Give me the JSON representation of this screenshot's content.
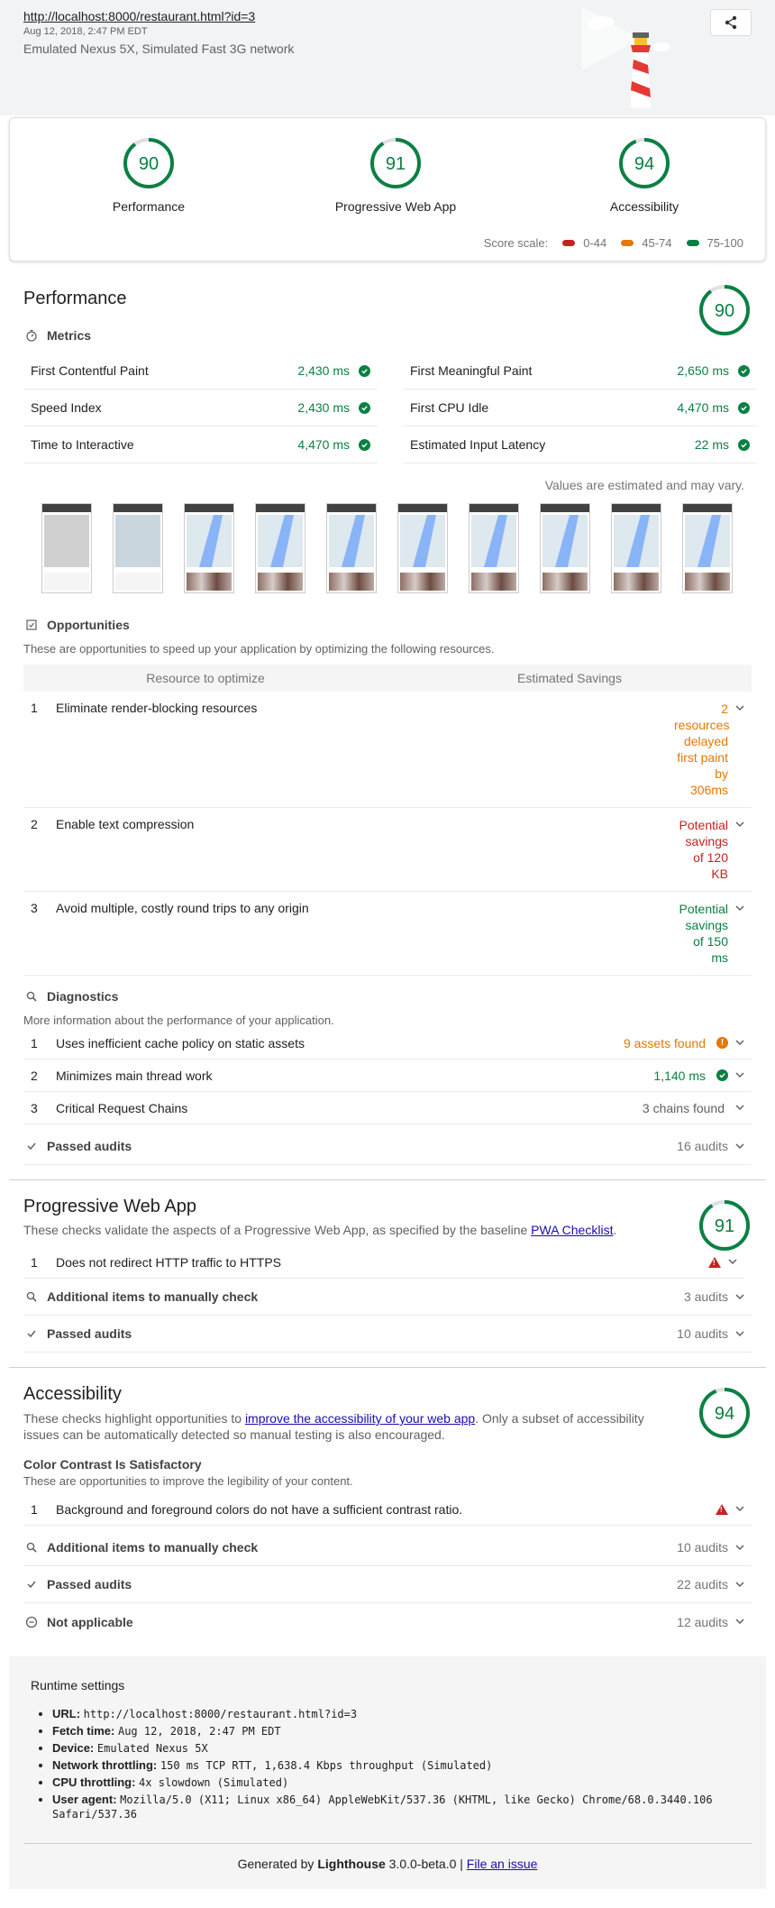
{
  "header": {
    "url": "http://localhost:8000/restaurant.html?id=3",
    "fetch_time": "Aug 12, 2018, 2:47 PM EDT",
    "device": "Emulated Nexus 5X, Simulated Fast 3G network",
    "share_icon": "share-icon"
  },
  "scores": {
    "items": [
      {
        "label": "Performance",
        "value": "90",
        "fraction": 0.9
      },
      {
        "label": "Progressive Web App",
        "value": "91",
        "fraction": 0.91
      },
      {
        "label": "Accessibility",
        "value": "94",
        "fraction": 0.94
      }
    ],
    "scale_label": "Score scale:",
    "scale": [
      {
        "label": "0-44",
        "color": "#c7221f"
      },
      {
        "label": "45-74",
        "color": "#e67700"
      },
      {
        "label": "75-100",
        "color": "#0b8043"
      }
    ]
  },
  "colors": {
    "pass": "#0b8043",
    "average": "#e67700",
    "fail": "#c7221f"
  },
  "performance": {
    "title": "Performance",
    "score": "90",
    "fraction": 0.9,
    "metrics_label": "Metrics",
    "metrics": [
      {
        "name": "First Contentful Paint",
        "value": "2,430 ms"
      },
      {
        "name": "First Meaningful Paint",
        "value": "2,650 ms"
      },
      {
        "name": "Speed Index",
        "value": "2,430 ms"
      },
      {
        "name": "First CPU Idle",
        "value": "4,470 ms"
      },
      {
        "name": "Time to Interactive",
        "value": "4,470 ms"
      },
      {
        "name": "Estimated Input Latency",
        "value": "22 ms"
      }
    ],
    "estimate_note": "Values are estimated and may vary.",
    "opportunities_label": "Opportunities",
    "opportunities_desc": "These are opportunities to speed up your application by optimizing the following resources.",
    "col_resource": "Resource to optimize",
    "col_savings": "Estimated Savings",
    "opportunities": [
      {
        "n": "1",
        "title": "Eliminate render-blocking resources",
        "savings": "2 resources delayed first paint by 306ms",
        "color": "#e67700"
      },
      {
        "n": "2",
        "title": "Enable text compression",
        "savings": "Potential savings of 120 KB",
        "color": "#c7221f"
      },
      {
        "n": "3",
        "title": "Avoid multiple, costly round trips to any origin",
        "savings": "Potential savings of 150 ms",
        "color": "#0b8043"
      }
    ],
    "diagnostics_label": "Diagnostics",
    "diagnostics_desc": "More information about the performance of your application.",
    "diagnostics": [
      {
        "n": "1",
        "title": "Uses inefficient cache policy on static assets",
        "value": "9 assets found"
      },
      {
        "n": "2",
        "title": "Minimizes main thread work",
        "value": "1,140 ms"
      },
      {
        "n": "3",
        "title": "Critical Request Chains",
        "value": "3 chains found"
      }
    ],
    "passed_label": "Passed audits",
    "passed_count": "16 audits"
  },
  "pwa": {
    "title": "Progressive Web App",
    "score": "91",
    "fraction": 0.91,
    "desc_prefix": "These checks validate the aspects of a Progressive Web App, as specified by the baseline ",
    "desc_link": "PWA Checklist",
    "desc_suffix": ".",
    "fail_n": "1",
    "fail_title": "Does not redirect HTTP traffic to HTTPS",
    "manual_label": "Additional items to manually check",
    "manual_count": "3 audits",
    "passed_label": "Passed audits",
    "passed_count": "10 audits"
  },
  "a11y": {
    "title": "Accessibility",
    "score": "94",
    "fraction": 0.94,
    "desc_prefix": "These checks highlight opportunities to ",
    "desc_link": "improve the accessibility of your web app",
    "desc_suffix": ". Only a subset of accessibility issues can be automatically detected so manual testing is also encouraged.",
    "group_title": "Color Contrast Is Satisfactory",
    "group_desc": "These are opportunities to improve the legibility of your content.",
    "fail_n": "1",
    "fail_title": "Background and foreground colors do not have a sufficient contrast ratio.",
    "manual_label": "Additional items to manually check",
    "manual_count": "10 audits",
    "passed_label": "Passed audits",
    "passed_count": "22 audits",
    "na_label": "Not applicable",
    "na_count": "12 audits"
  },
  "runtime": {
    "title": "Runtime settings",
    "items": [
      {
        "k": "URL:",
        "v": "http://localhost:8000/restaurant.html?id=3"
      },
      {
        "k": "Fetch time:",
        "v": "Aug 12, 2018, 2:47 PM EDT"
      },
      {
        "k": "Device:",
        "v": "Emulated Nexus 5X"
      },
      {
        "k": "Network throttling:",
        "v": "150 ms TCP RTT, 1,638.4 Kbps throughput (Simulated)"
      },
      {
        "k": "CPU throttling:",
        "v": "4x slowdown (Simulated)"
      },
      {
        "k": "User agent:",
        "v": "Mozilla/5.0 (X11; Linux x86_64) AppleWebKit/537.36 (KHTML, like Gecko) Chrome/68.0.3440.106 Safari/537.36"
      }
    ]
  },
  "footer": {
    "prefix": "Generated by ",
    "brand": "Lighthouse",
    "version": " 3.0.0-beta.0 | ",
    "issue_link": "File an issue"
  }
}
